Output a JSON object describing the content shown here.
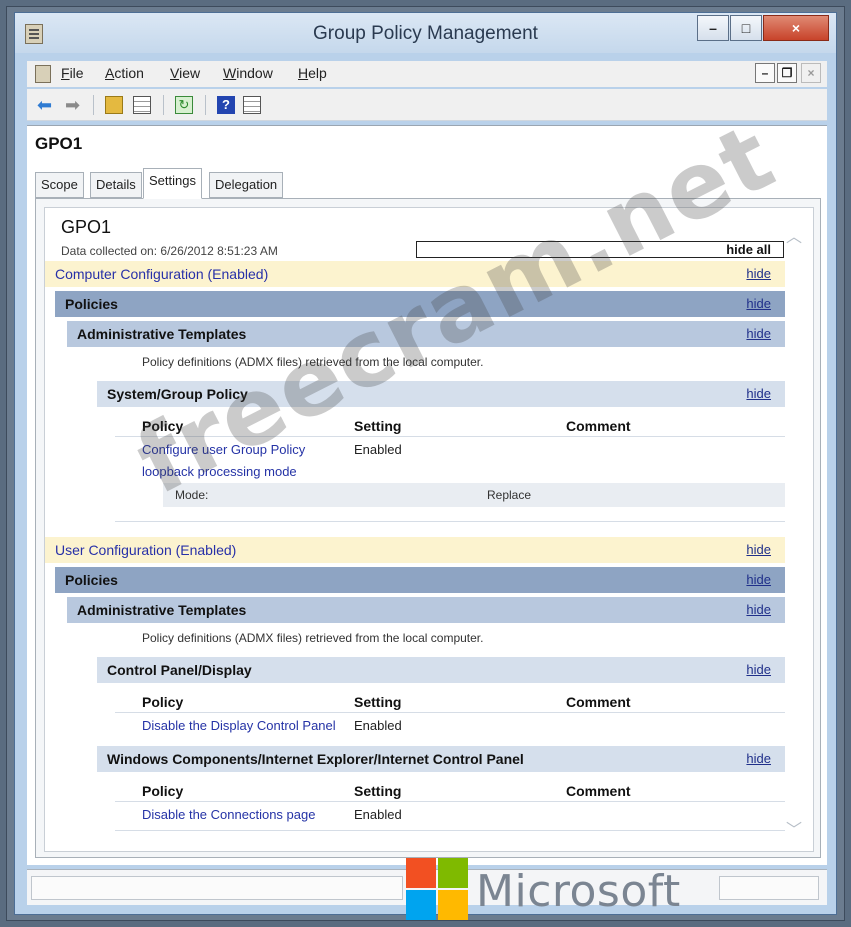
{
  "window": {
    "title": "Group Policy Management"
  },
  "menubar": {
    "items": [
      {
        "accel": "F",
        "rest": "ile"
      },
      {
        "accel": "A",
        "rest": "ction"
      },
      {
        "accel": "V",
        "rest": "iew"
      },
      {
        "accel": "W",
        "rest": "indow"
      },
      {
        "accel": "H",
        "rest": "elp"
      }
    ]
  },
  "console": {
    "gpo_name": "GPO1",
    "tabs": [
      "Scope",
      "Details",
      "Settings",
      "Delegation"
    ],
    "active_tab": "Settings"
  },
  "report": {
    "title": "GPO1",
    "data_collected": "Data collected on: 6/26/2012 8:51:23 AM",
    "hide_all": "hide all",
    "hide": "hide",
    "computer_config": {
      "header": "Computer Configuration (Enabled)",
      "policies": "Policies",
      "admin_templates": "Administrative Templates",
      "note": "Policy definitions (ADMX files) retrieved from the local computer.",
      "category": "System/Group Policy",
      "columns": [
        "Policy",
        "Setting",
        "Comment"
      ],
      "policy_line1": "Configure user Group Policy",
      "policy_line2": "loopback processing mode",
      "policy_setting": "Enabled",
      "mode_label": "Mode:",
      "mode_value": "Replace"
    },
    "user_config": {
      "header": "User Configuration (Enabled)",
      "policies": "Policies",
      "admin_templates": "Administrative Templates",
      "note": "Policy definitions (ADMX files) retrieved from the local computer.",
      "category1": "Control Panel/Display",
      "columns": [
        "Policy",
        "Setting",
        "Comment"
      ],
      "policy1": "Disable the Display Control Panel",
      "policy1_setting": "Enabled",
      "category2": "Windows Components/Internet Explorer/Internet Control Panel",
      "policy2": "Disable the Connections page",
      "policy2_setting": "Enabled"
    }
  },
  "branding": {
    "logo_text": "Microsoft",
    "watermark": "freecram.net"
  },
  "colors": {
    "logo_red": "#f25022",
    "logo_green": "#7fba00",
    "logo_blue": "#00a4ef",
    "logo_yellow": "#ffb900"
  }
}
